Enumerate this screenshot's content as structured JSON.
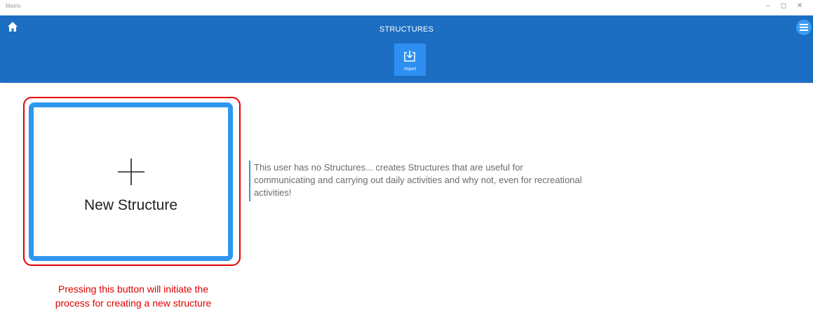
{
  "window": {
    "app_name": "Matrix",
    "minimize": "–",
    "restore": "◻",
    "close": "✕"
  },
  "header": {
    "title": "STRUCTURES",
    "home_icon": "home-icon",
    "menu_icon": "hamburger-menu-icon",
    "import_label": "Import",
    "import_icon": "import-icon"
  },
  "main": {
    "new_structure_label": "New Structure",
    "plus_icon": "plus-icon",
    "empty_message": "This user has no Structures... creates Structures that are useful for communicating and carrying out daily activities and why not, even for recreational activities!"
  },
  "annotation": {
    "line1": "Pressing this button will initiate the",
    "line2": "process for creating a new structure"
  },
  "colors": {
    "header_bg": "#1b6ec2",
    "accent": "#2f96f0",
    "annotation_red": "#e00000"
  }
}
